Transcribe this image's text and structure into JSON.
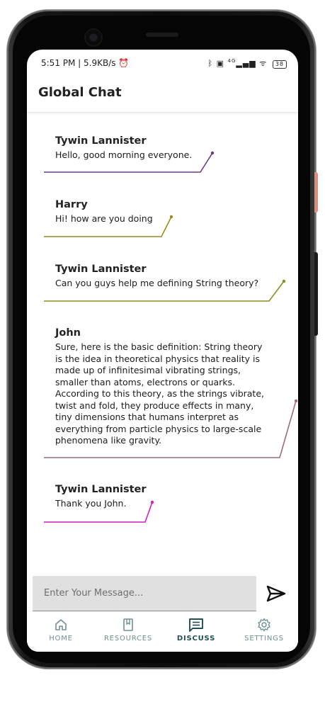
{
  "status_bar": {
    "time": "5:51 PM | 5.9KB/s",
    "signal_label": "4G",
    "battery": "38"
  },
  "app": {
    "title": "Global Chat"
  },
  "messages": [
    {
      "sender": "Tywin Lannister",
      "text": "Hello, good morning everyone.",
      "color": "#6a3b86"
    },
    {
      "sender": "Harry",
      "text": "Hi! how are you doing",
      "color": "#9a8a1c"
    },
    {
      "sender": "Tywin Lannister",
      "text": "Can you guys help me defining String theory?",
      "color": "#8c8d1f"
    },
    {
      "sender": "John",
      "text": "Sure, here is the basic definition: String theory is the idea in theoretical physics that reality is made up of infinitesimal vibrating strings, smaller than atoms, electrons or quarks. According to this theory, as the strings vibrate, twist and fold, they produce effects in many, tiny dimensions that humans interpret as everything from particle physics to large-scale phenomena like gravity.",
      "color": "#9a6e79"
    },
    {
      "sender": "Tywin Lannister",
      "text": "Thank you John.",
      "color": "#d21fc0"
    }
  ],
  "composer": {
    "placeholder": "Enter Your Message..."
  },
  "nav": {
    "items": [
      {
        "label": "HOME",
        "icon": "home-icon"
      },
      {
        "label": "RESOURCES",
        "icon": "book-icon"
      },
      {
        "label": "DISCUSS",
        "icon": "chat-icon"
      },
      {
        "label": "SETTINGS",
        "icon": "gear-icon"
      }
    ],
    "active": "DISCUSS"
  },
  "colors": {
    "nav_active": "#1f4f55",
    "nav_inactive": "#6f8f93"
  }
}
